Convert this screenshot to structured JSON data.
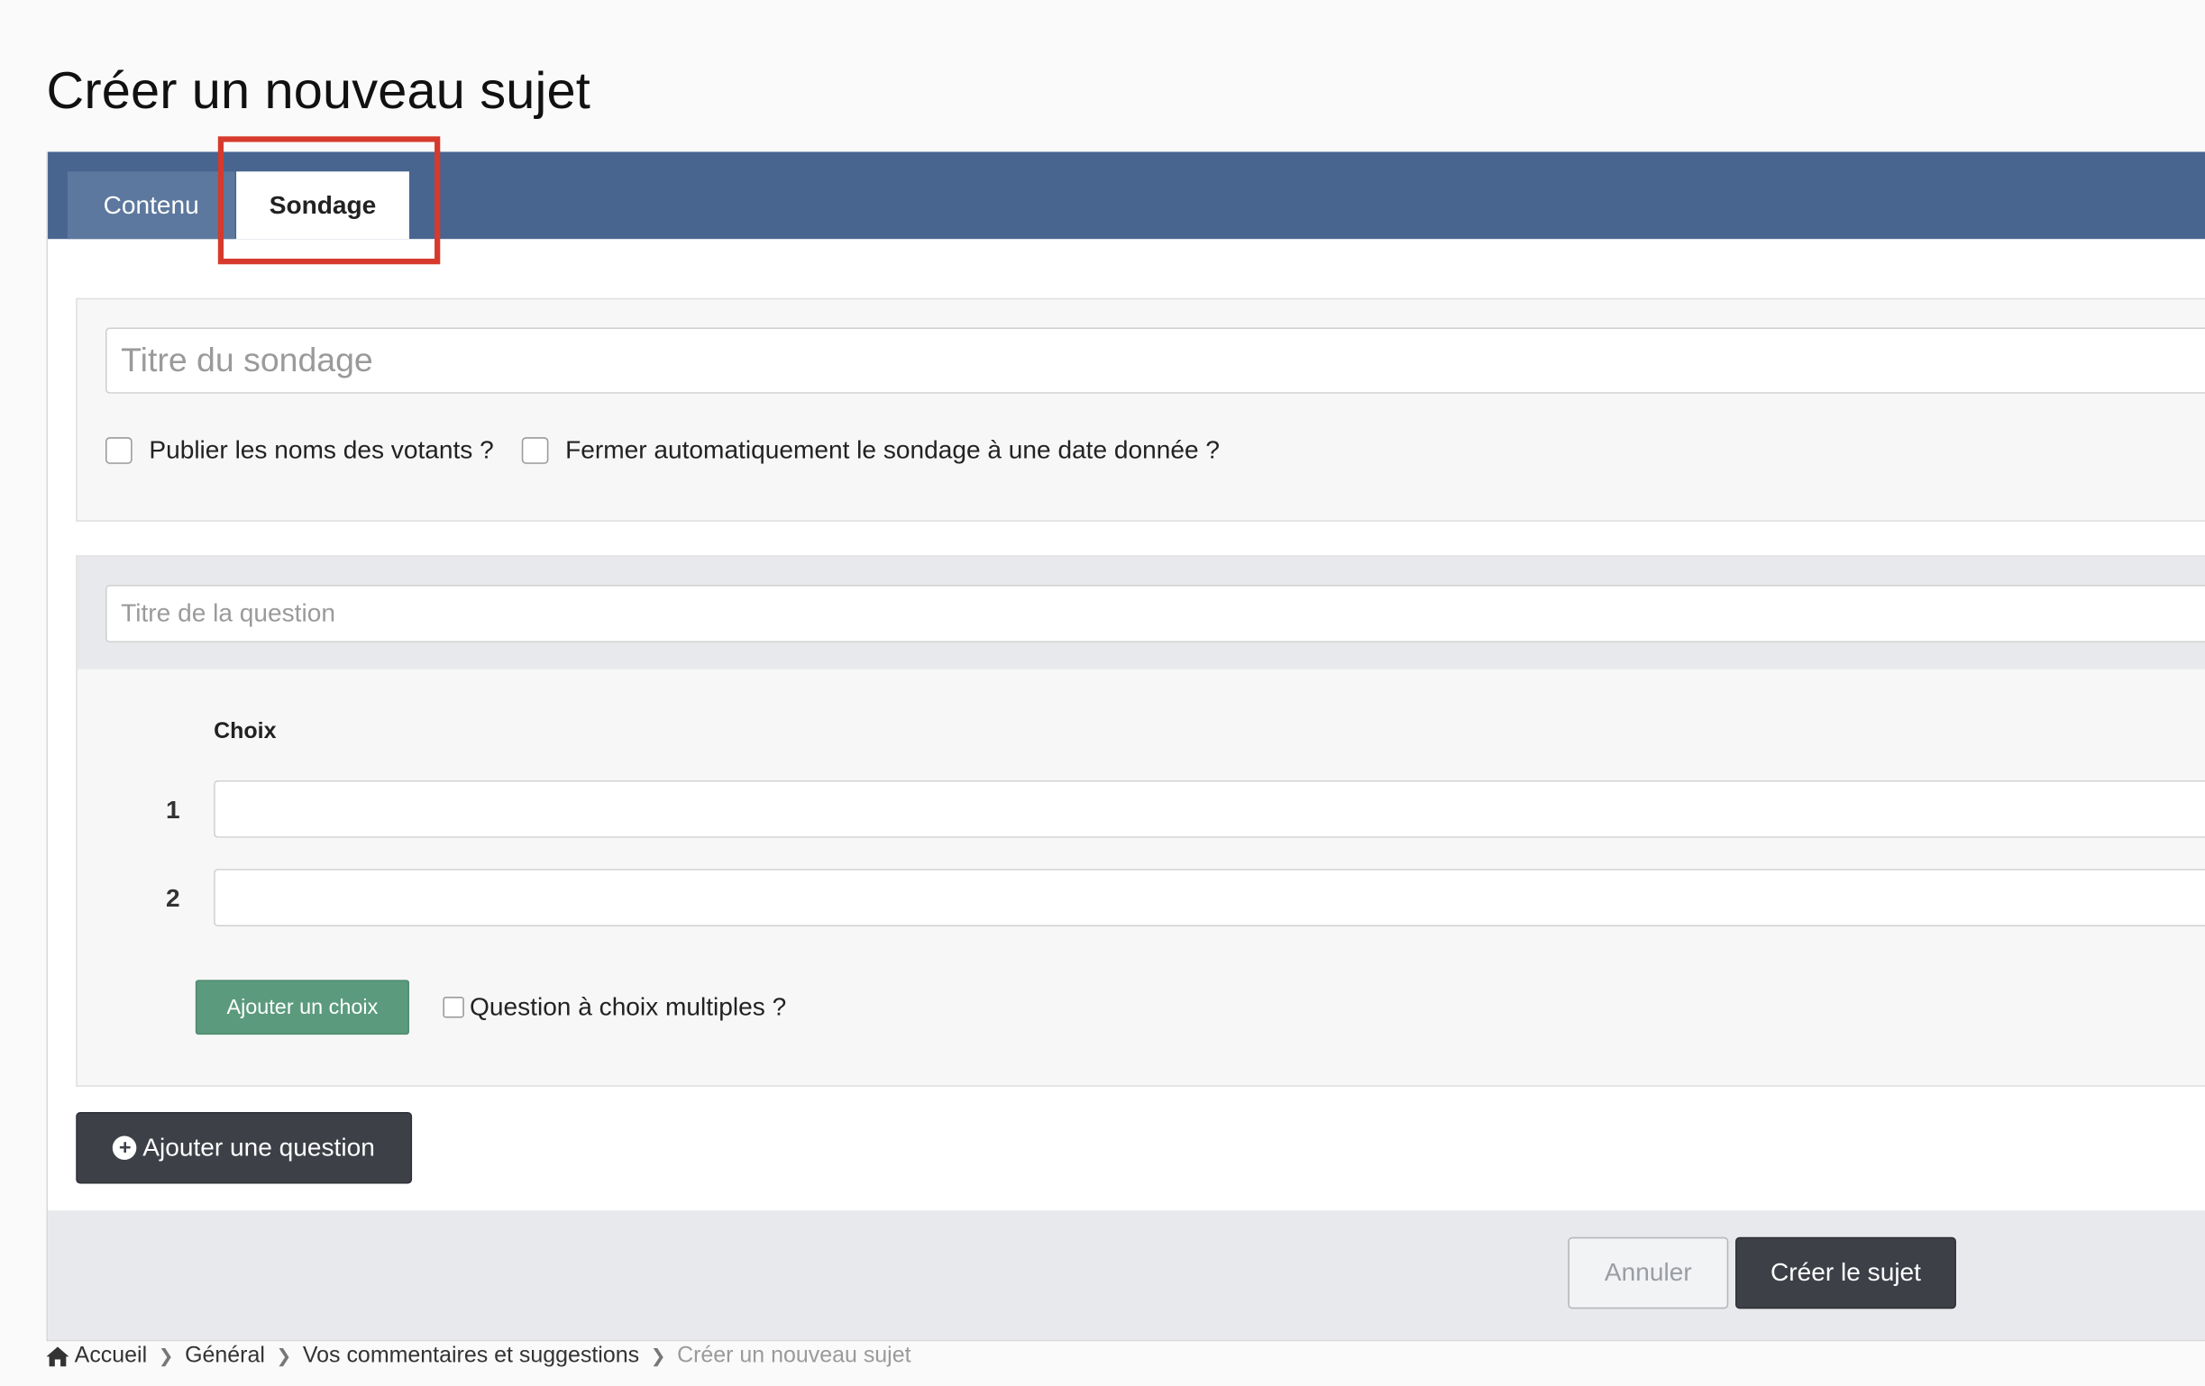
{
  "page": {
    "title": "Créer un nouveau sujet"
  },
  "tabs": [
    {
      "label": "Contenu",
      "active": false
    },
    {
      "label": "Sondage",
      "active": true
    }
  ],
  "poll": {
    "title_placeholder": "Titre du sondage",
    "title_value": "",
    "option_public_voters": {
      "label": "Publier les noms des votants ?",
      "checked": false
    },
    "option_auto_close": {
      "label": "Fermer automatiquement le sondage à une date donnée ?",
      "checked": false
    }
  },
  "question": {
    "title_placeholder": "Titre de la question",
    "title_value": "",
    "choices_label": "Choix",
    "choices": [
      {
        "number": "1",
        "value": ""
      },
      {
        "number": "2",
        "value": ""
      }
    ],
    "add_choice_label": "Ajouter un choix",
    "multiple_choice": {
      "label": "Question à choix multiples ?",
      "checked": false
    }
  },
  "add_question_label": "Ajouter une question",
  "footer": {
    "cancel_label": "Annuler",
    "submit_label": "Créer le sujet"
  },
  "breadcrumb": [
    {
      "label": "Accueil",
      "icon": "home-icon"
    },
    {
      "label": "Général"
    },
    {
      "label": "Vos commentaires et suggestions"
    },
    {
      "label": "Créer un nouveau sujet",
      "current": true
    }
  ],
  "colors": {
    "tab_bar": "#486590",
    "highlight": "#d63a2c",
    "add_choice_button": "#5b9a7d",
    "primary_button": "#3d4047"
  },
  "icons": {
    "add_question": "plus-circle-icon",
    "breadcrumb_separator": "chevron-right-icon"
  }
}
